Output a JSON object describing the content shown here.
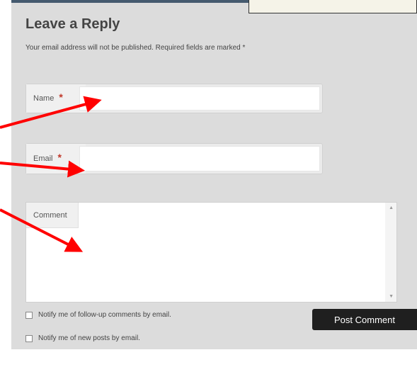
{
  "form": {
    "title": "Leave a Reply",
    "notes": "Your email address will not be published. Required fields are marked *",
    "required_mark": "*",
    "name_label": "Name",
    "email_label": "Email",
    "comment_label": "Comment",
    "notify_followup_label": "Notify me of follow-up comments by email.",
    "notify_posts_label": "Notify me of new posts by email.",
    "submit_label": "Post Comment"
  },
  "icons": {
    "scroll_up": "scroll-up-arrow",
    "scroll_down": "scroll-down-arrow",
    "annotation": "red-arrow"
  },
  "colors": {
    "panel_bg": "#dcdcdc",
    "button_bg": "#1f1f1f",
    "required": "#c0392b",
    "annotation_arrow": "#ff0000"
  }
}
